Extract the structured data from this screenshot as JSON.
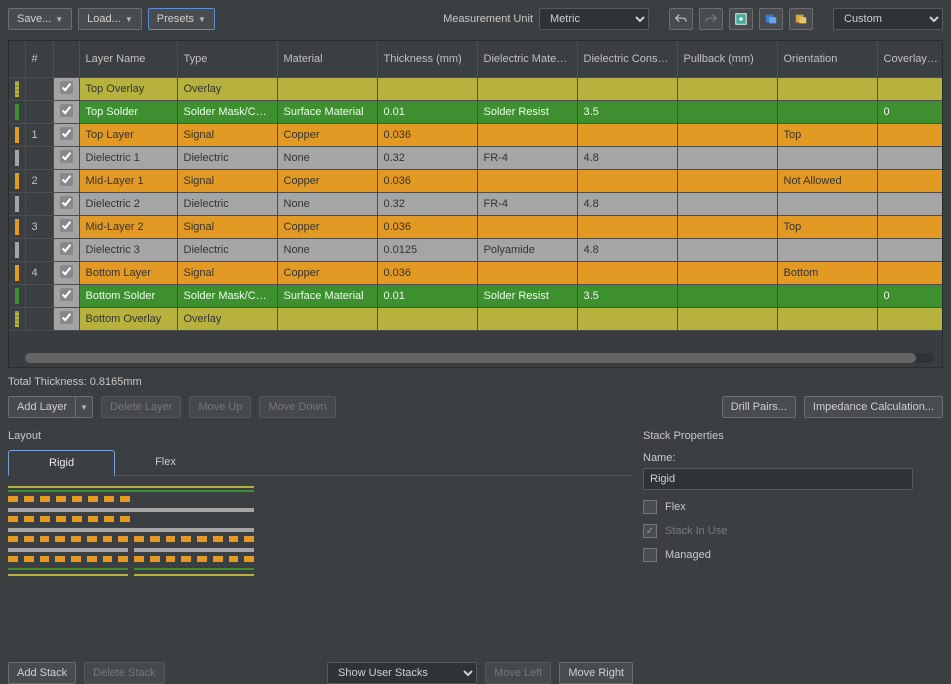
{
  "toolbar": {
    "save": "Save...",
    "load": "Load...",
    "presets": "Presets",
    "measurement_label": "Measurement Unit",
    "measurement_value": "Metric",
    "right_dropdown": "Custom"
  },
  "columns": [
    "",
    "#",
    "",
    "Layer Name",
    "Type",
    "Material",
    "Thickness (mm)",
    "Dielectric Material",
    "Dielectric Constant",
    "Pullback (mm)",
    "Orientation",
    "Coverlay Expansion"
  ],
  "rows": [
    {
      "kind": "olive",
      "num": "",
      "chk": true,
      "name": "Top Overlay",
      "type": "Overlay",
      "mat": "",
      "thk": "",
      "dmat": "",
      "dk": "",
      "pb": "",
      "orient": "",
      "cov": ""
    },
    {
      "kind": "green",
      "num": "",
      "chk": true,
      "name": "Top Solder",
      "type": "Solder Mask/Co...",
      "mat": "Surface Material",
      "thk": "0.01",
      "dmat": "Solder Resist",
      "dk": "3.5",
      "pb": "",
      "orient": "",
      "cov": "0"
    },
    {
      "kind": "orange",
      "num": "1",
      "chk": true,
      "name": "Top Layer",
      "type": "Signal",
      "mat": "Copper",
      "thk": "0.036",
      "dmat": "",
      "dk": "",
      "pb": "",
      "orient": "Top",
      "cov": ""
    },
    {
      "kind": "gray",
      "num": "",
      "chk": true,
      "name": "Dielectric 1",
      "type": "Dielectric",
      "mat": "None",
      "thk": "0.32",
      "dmat": "FR-4",
      "dk": "4.8",
      "pb": "",
      "orient": "",
      "cov": ""
    },
    {
      "kind": "orange",
      "num": "2",
      "chk": true,
      "name": "Mid-Layer 1",
      "type": "Signal",
      "mat": "Copper",
      "thk": "0.036",
      "dmat": "",
      "dk": "",
      "pb": "",
      "orient": "Not Allowed",
      "cov": ""
    },
    {
      "kind": "gray",
      "num": "",
      "chk": true,
      "name": "Dielectric 2",
      "type": "Dielectric",
      "mat": "None",
      "thk": "0.32",
      "dmat": "FR-4",
      "dk": "4.8",
      "pb": "",
      "orient": "",
      "cov": ""
    },
    {
      "kind": "orange",
      "num": "3",
      "chk": true,
      "name": "Mid-Layer 2",
      "type": "Signal",
      "mat": "Copper",
      "thk": "0.036",
      "dmat": "",
      "dk": "",
      "pb": "",
      "orient": "Top",
      "cov": ""
    },
    {
      "kind": "gray",
      "num": "",
      "chk": true,
      "name": "Dielectric 3",
      "type": "Dielectric",
      "mat": "None",
      "thk": "0.0125",
      "dmat": "Polyamide",
      "dk": "4.8",
      "pb": "",
      "orient": "",
      "cov": ""
    },
    {
      "kind": "orange",
      "num": "4",
      "chk": true,
      "name": "Bottom Layer",
      "type": "Signal",
      "mat": "Copper",
      "thk": "0.036",
      "dmat": "",
      "dk": "",
      "pb": "",
      "orient": "Bottom",
      "cov": ""
    },
    {
      "kind": "green",
      "num": "",
      "chk": true,
      "name": "Bottom Solder",
      "type": "Solder Mask/Co...",
      "mat": "Surface Material",
      "thk": "0.01",
      "dmat": "Solder Resist",
      "dk": "3.5",
      "pb": "",
      "orient": "",
      "cov": "0"
    },
    {
      "kind": "olive",
      "num": "",
      "chk": true,
      "name": "Bottom Overlay",
      "type": "Overlay",
      "mat": "",
      "thk": "",
      "dmat": "",
      "dk": "",
      "pb": "",
      "orient": "",
      "cov": ""
    }
  ],
  "total": "Total Thickness: 0.8165mm",
  "buttons": {
    "add_layer": "Add Layer",
    "delete_layer": "Delete Layer",
    "move_up": "Move Up",
    "move_down": "Move Down",
    "drill_pairs": "Drill Pairs...",
    "impedance": "Impedance Calculation...",
    "add_stack": "Add Stack",
    "delete_stack": "Delete Stack",
    "move_left": "Move Left",
    "move_right": "Move Right",
    "show_user_stacks": "Show User Stacks"
  },
  "layout": {
    "title": "Layout",
    "tabs": [
      "Rigid",
      "Flex"
    ]
  },
  "props": {
    "title": "Stack Properties",
    "name_label": "Name:",
    "name_value": "Rigid",
    "flex_label": "Flex",
    "stack_in_use_label": "Stack In Use",
    "managed_label": "Managed"
  }
}
